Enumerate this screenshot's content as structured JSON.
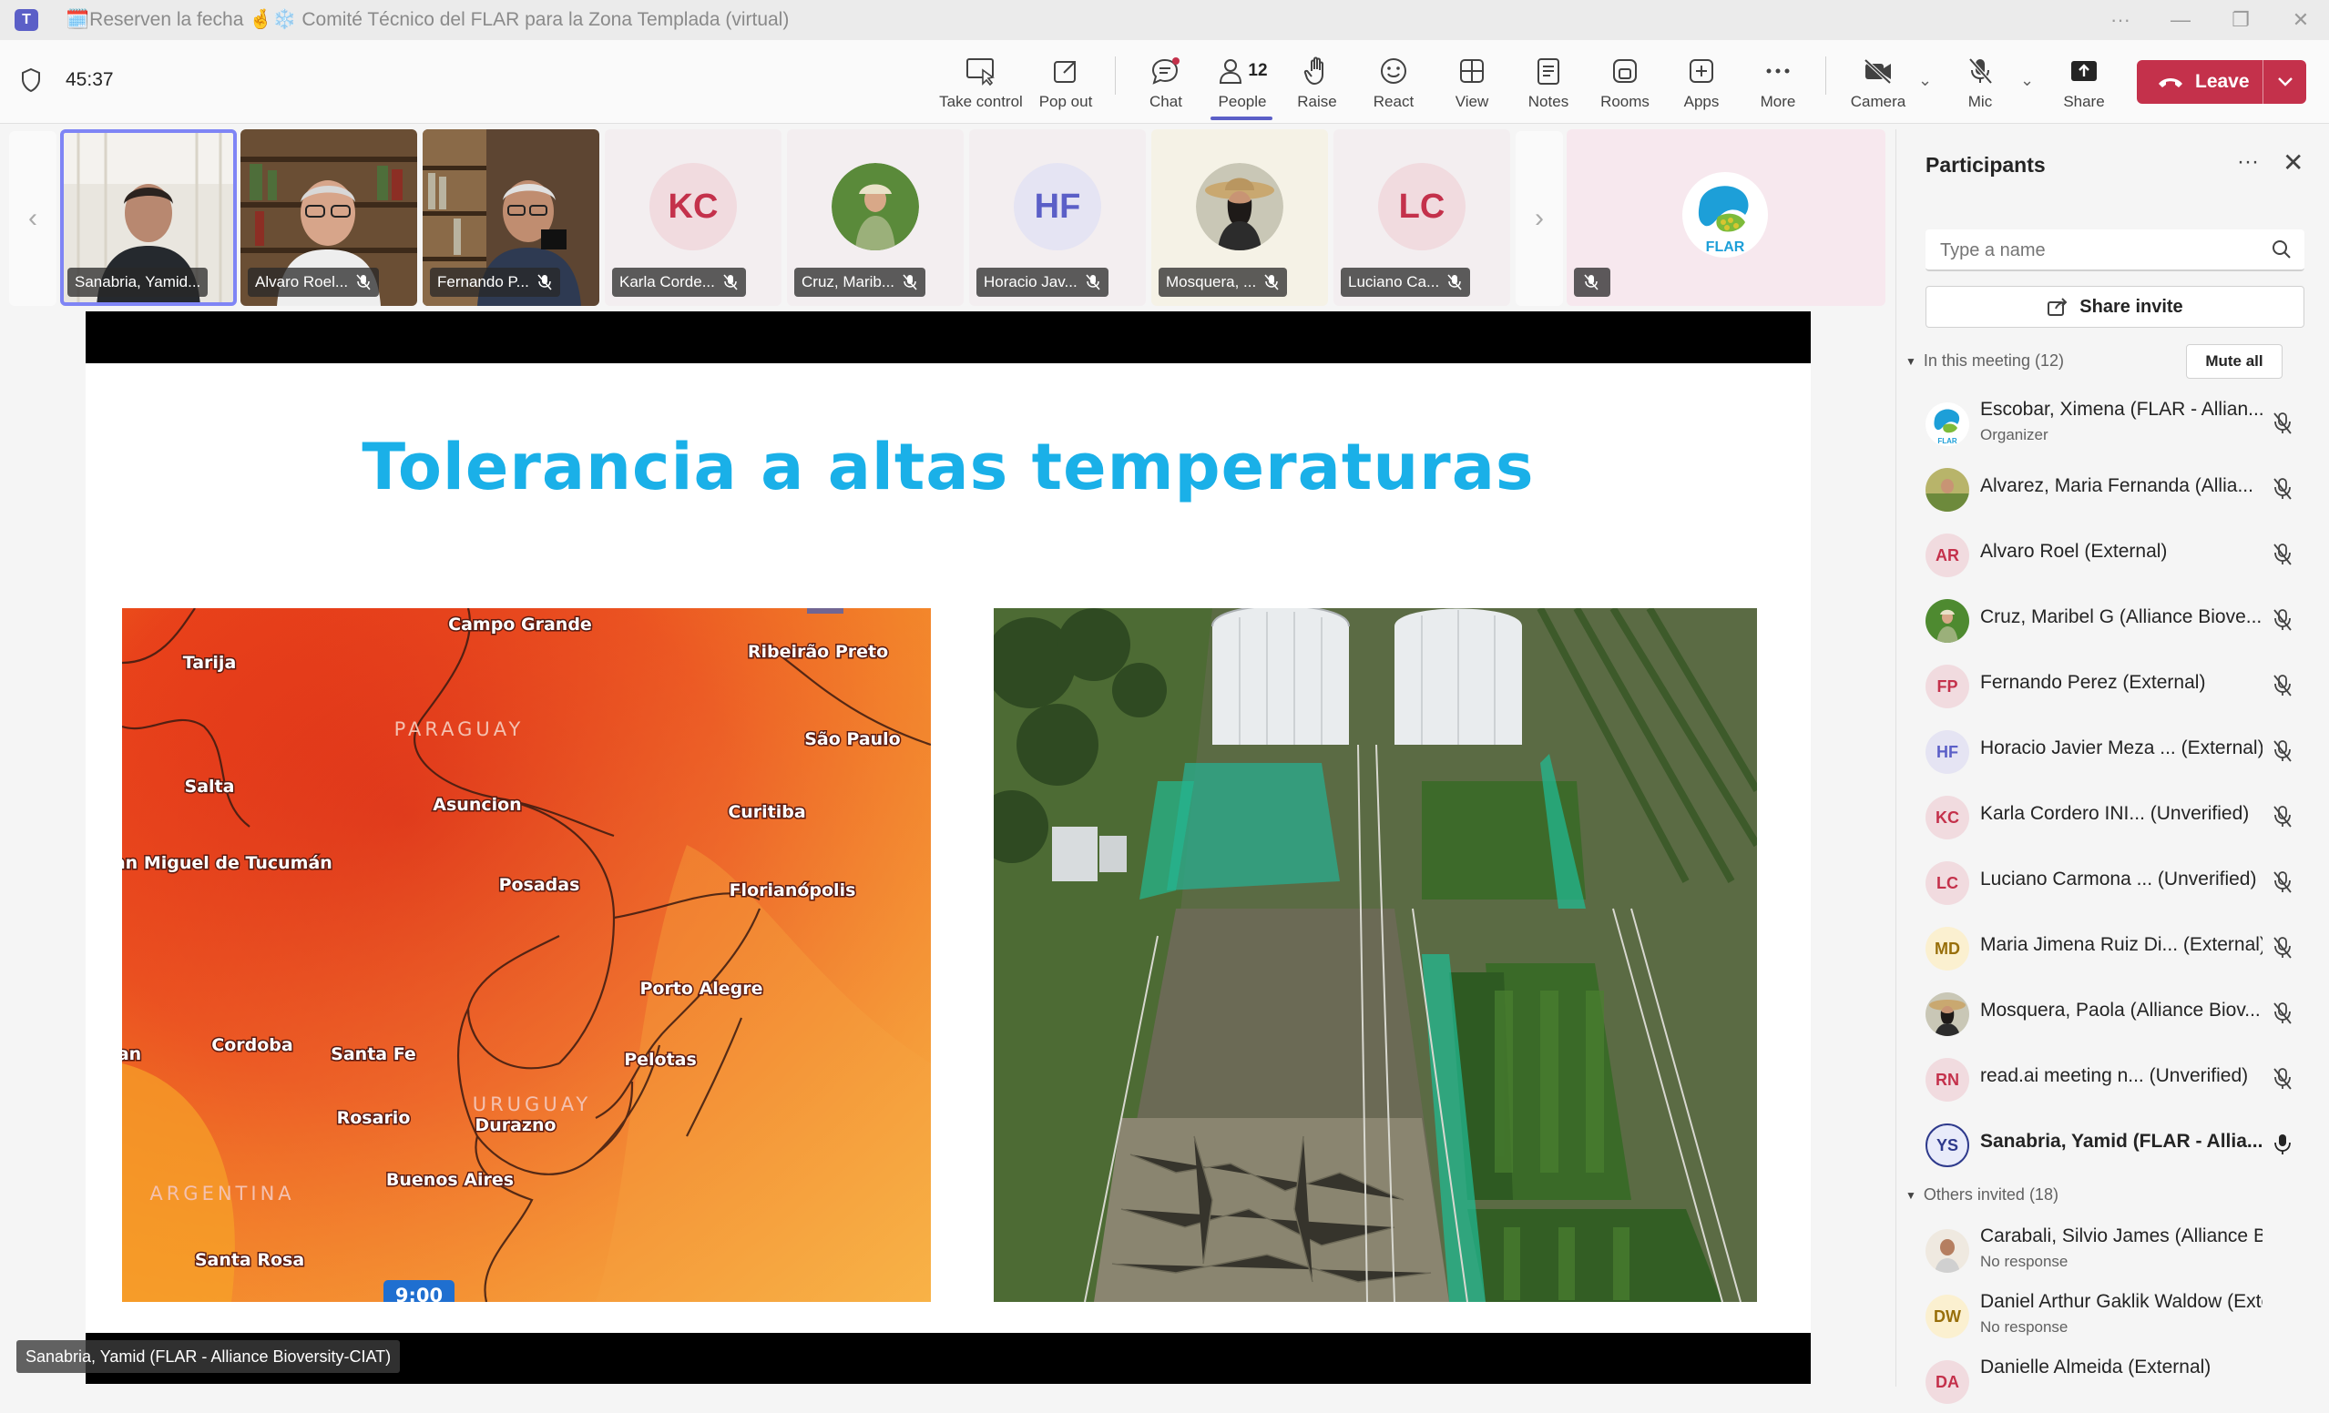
{
  "window": {
    "title": "🗓️Reserven la fecha 🤞❄️ Comité Técnico del FLAR para la Zona Templada (virtual)",
    "icon": "teams-logo"
  },
  "toolbar": {
    "timer": "45:37",
    "buttons": [
      {
        "id": "take-control",
        "label": "Take control",
        "icon": "take-control-icon"
      },
      {
        "id": "pop-out",
        "label": "Pop out",
        "icon": "pop-out-icon"
      },
      {
        "id": "chat",
        "label": "Chat",
        "icon": "chat-icon"
      },
      {
        "id": "people",
        "label": "People",
        "icon": "people-icon",
        "count": "12"
      },
      {
        "id": "raise",
        "label": "Raise",
        "icon": "hand-icon"
      },
      {
        "id": "react",
        "label": "React",
        "icon": "smiley-icon"
      },
      {
        "id": "view",
        "label": "View",
        "icon": "grid-icon"
      },
      {
        "id": "notes",
        "label": "Notes",
        "icon": "notes-icon"
      },
      {
        "id": "rooms",
        "label": "Rooms",
        "icon": "rooms-icon"
      },
      {
        "id": "apps",
        "label": "Apps",
        "icon": "plus-icon"
      },
      {
        "id": "more",
        "label": "More",
        "icon": "more-icon"
      },
      {
        "id": "camera",
        "label": "Camera",
        "icon": "camera-off-icon"
      },
      {
        "id": "mic",
        "label": "Mic",
        "icon": "mic-off-icon"
      },
      {
        "id": "share",
        "label": "Share",
        "icon": "share-icon"
      }
    ],
    "leave_label": "Leave",
    "accent": "#5b5fc7",
    "leave_color": "#c4314b"
  },
  "gallery": [
    {
      "name": "Sanabria, Yamid...",
      "type": "video",
      "active": true
    },
    {
      "name": "Alvaro Roel...",
      "type": "video"
    },
    {
      "name": "Fernando P...",
      "type": "video"
    },
    {
      "name": "Karla Corde...",
      "type": "avatar",
      "initials": "KC",
      "color": "#c4314b",
      "bg": "#f1dbdf"
    },
    {
      "name": "Cruz, Marib...",
      "type": "photo"
    },
    {
      "name": "Horacio Jav...",
      "type": "avatar",
      "initials": "HF",
      "color": "#5b5fc7",
      "bg": "#e5e4f3"
    },
    {
      "name": "Mosquera, ...",
      "type": "photo"
    },
    {
      "name": "Luciano Ca...",
      "type": "avatar",
      "initials": "LC",
      "color": "#c4314b",
      "bg": "#f1dbdf"
    },
    {
      "name": "",
      "type": "logo",
      "logo_text": "FLAR"
    }
  ],
  "slide": {
    "title": "Tolerancia a altas temperaturas",
    "map_labels": {
      "campo_grande": "Campo Grande",
      "tarija": "Tarija",
      "ribeirao": "Ribeirão Preto",
      "paraguay": "PARAGUAY",
      "sao_paulo": "São Paulo",
      "salta": "Salta",
      "asuncion": "Asuncion",
      "curitiba": "Curitiba",
      "tucuman": "San Miguel de Tucumán",
      "posadas": "Posadas",
      "florianopolis": "Florianópolis",
      "porto_alegre": "Porto Alegre",
      "an": "an",
      "cordoba": "Cordoba",
      "santa_fe": "Santa Fe",
      "pelotas": "Pelotas",
      "uruguay": "URUGUAY",
      "rosario": "Rosario",
      "durazno": "Durazno",
      "buenos_aires": "Buenos Aires",
      "argentina": "ARGENTINA",
      "santa_rosa": "Santa Rosa",
      "time": "9:00"
    }
  },
  "speaker_tag": "Sanabria, Yamid (FLAR - Alliance Bioversity-CIAT)",
  "panel": {
    "title": "Participants",
    "search_placeholder": "Type a name",
    "share_invite": "Share invite",
    "in_meeting_header": "In this meeting (12)",
    "mute_all": "Mute all",
    "others_header": "Others invited (18)",
    "in_meeting": [
      {
        "name": "Escobar, Ximena (FLAR - Allian...",
        "sub": "Organizer",
        "av": "logo",
        "mic": "off"
      },
      {
        "name": "Alvarez, Maria Fernanda (Allia...",
        "av": "photo-field",
        "mic": "off"
      },
      {
        "name": "Alvaro Roel (External)",
        "initials": "AR",
        "color": "#c4314b",
        "bg": "#f1dbdf",
        "mic": "off"
      },
      {
        "name": "Cruz, Maribel G (Alliance Biove...",
        "av": "photo-green",
        "mic": "off"
      },
      {
        "name": "Fernando Perez (External)",
        "initials": "FP",
        "color": "#c4314b",
        "bg": "#f1dbdf",
        "mic": "off"
      },
      {
        "name": "Horacio Javier Meza ... (External)",
        "initials": "HF",
        "color": "#5b5fc7",
        "bg": "#e5e4f3",
        "mic": "off"
      },
      {
        "name": "Karla Cordero INI... (Unverified)",
        "initials": "KC",
        "color": "#c4314b",
        "bg": "#f1dbdf",
        "mic": "off"
      },
      {
        "name": "Luciano Carmona ... (Unverified)",
        "initials": "LC",
        "color": "#c4314b",
        "bg": "#f1dbdf",
        "mic": "off"
      },
      {
        "name": "Maria Jimena Ruiz Di... (External)",
        "initials": "MD",
        "color": "#986f0b",
        "bg": "#fbf0d0",
        "mic": "off"
      },
      {
        "name": "Mosquera, Paola (Alliance Biov...",
        "av": "photo-woman",
        "mic": "off"
      },
      {
        "name": "read.ai meeting n... (Unverified)",
        "initials": "RN",
        "color": "#c4314b",
        "bg": "#f1dbdf",
        "mic": "off"
      },
      {
        "name": "Sanabria, Yamid (FLAR - Allia...",
        "initials": "YS",
        "color": "#2e3a8c",
        "bg": "#e8ebfa",
        "mic": "on",
        "me": true
      }
    ],
    "others": [
      {
        "name": "Carabali, Silvio James (Alliance Bio...",
        "sub": "No response",
        "av": "photo-man"
      },
      {
        "name": "Daniel Arthur Gaklik Waldow (Exte...",
        "sub": "No response",
        "initials": "DW",
        "color": "#986f0b",
        "bg": "#fbf0d0"
      },
      {
        "name": "Danielle Almeida (External)",
        "initials": "DA",
        "color": "#c4314b",
        "bg": "#f1dbdf"
      }
    ]
  }
}
